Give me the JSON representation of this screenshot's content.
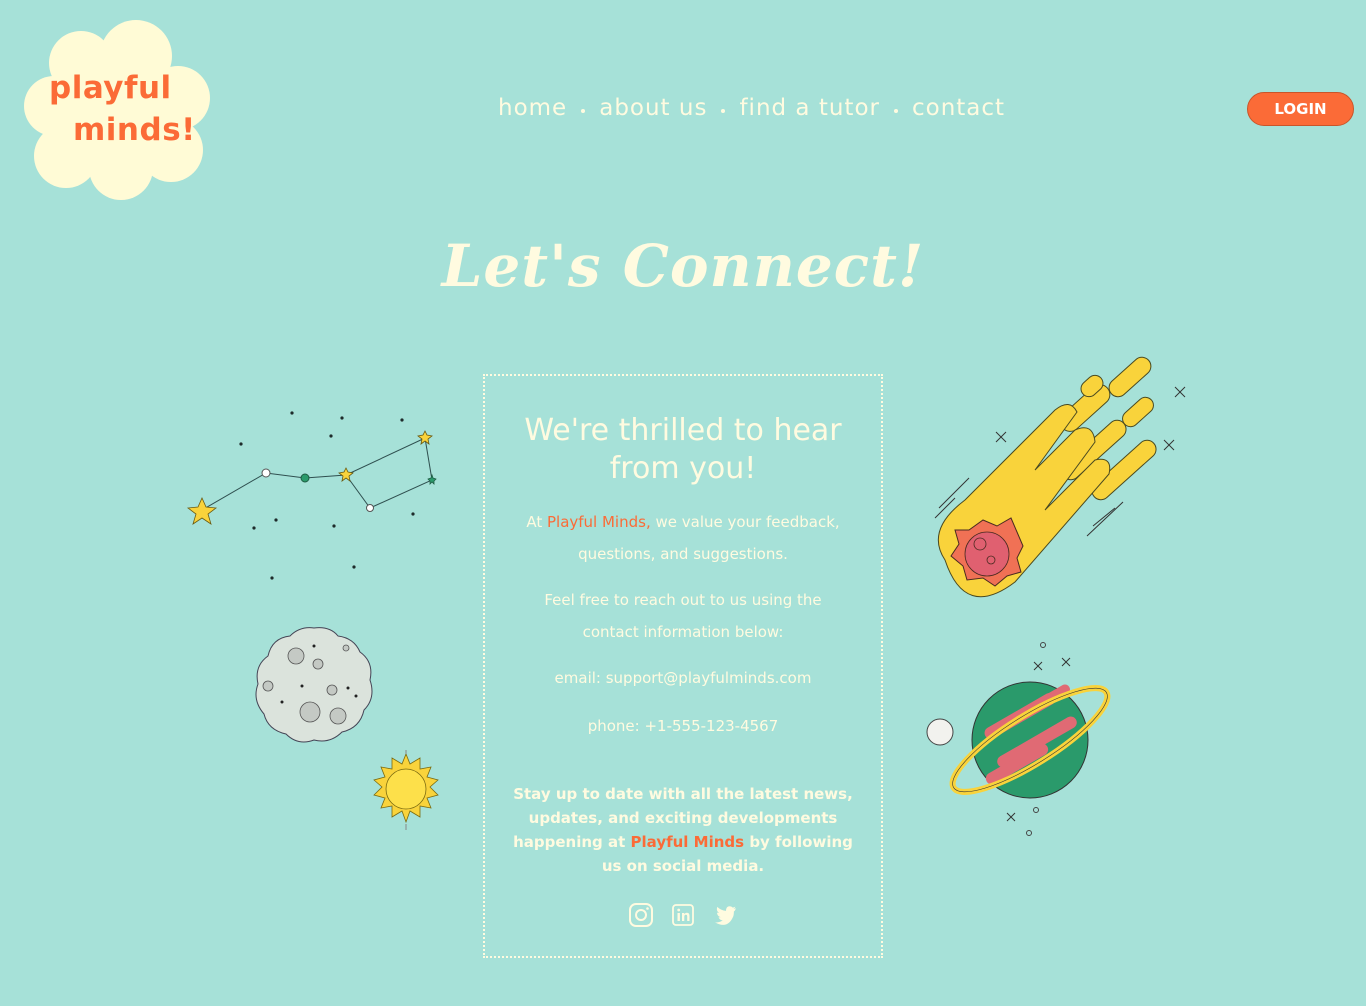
{
  "logo": {
    "line1": "playful",
    "line2": "minds!"
  },
  "nav": [
    {
      "label": "home"
    },
    {
      "label": "about us"
    },
    {
      "label": "find a tutor"
    },
    {
      "label": "contact"
    }
  ],
  "login_label": "LOGIN",
  "page_title": "Let's Connect!",
  "card": {
    "heading": "We're thrilled to hear from you!",
    "p1_prefix": "At ",
    "p1_brand": "Playful Minds,",
    "p1_suffix": " we value your feedback, questions, and suggestions.",
    "p2": "Feel free to reach out to us using the contact information below:",
    "email": "email: support@playfulminds.com",
    "phone": "phone: +1-555-123-4567",
    "social_prefix": "Stay up to date with all the latest news, updates, and exciting developments happening at ",
    "social_brand": "Playful Minds",
    "social_suffix": " by following us on social media."
  },
  "social_icons": [
    "instagram-icon",
    "linkedin-icon",
    "twitter-icon"
  ],
  "colors": {
    "background": "#a6e1d8",
    "accent": "#fb6b37",
    "cream": "#fffbe0"
  }
}
